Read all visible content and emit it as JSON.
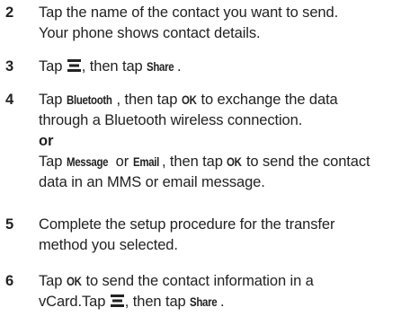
{
  "steps": [
    {
      "number": "2",
      "lines": [
        "Tap the name of the contact you want to send.",
        "Your phone shows contact details."
      ]
    },
    {
      "number": "3",
      "text_tap": "Tap",
      "text_then_tap": ", then tap",
      "key_share": "Share",
      "text_end": "."
    },
    {
      "number": "4",
      "text_tap": "Tap",
      "key_bluetooth": "Bluetooth",
      "text_then_tap": ", then tap",
      "key_ok": "OK",
      "text_rest_1": "to exchange the data",
      "line_2": "through a Bluetooth wireless connection.",
      "or_label": "or",
      "text_tap_2": "Tap",
      "key_message": "Message",
      "text_or": "or",
      "key_email": "Email",
      "text_then_tap_2": ", then tap",
      "key_ok_2": "OK",
      "text_rest_2": "to send the contact",
      "line_5": "data in an MMS or email message."
    },
    {
      "number": "5",
      "lines": [
        "Complete the setup procedure for the transfer",
        "method you selected."
      ]
    },
    {
      "number": "6",
      "text_tap": "Tap",
      "key_ok": "OK",
      "text_rest_1": "to send the contact information in a",
      "text_vcard": "vCard.Tap",
      "text_then_tap": ", then tap",
      "key_share": "Share",
      "text_end": "."
    }
  ],
  "icons": {
    "menu": "menu-icon"
  }
}
